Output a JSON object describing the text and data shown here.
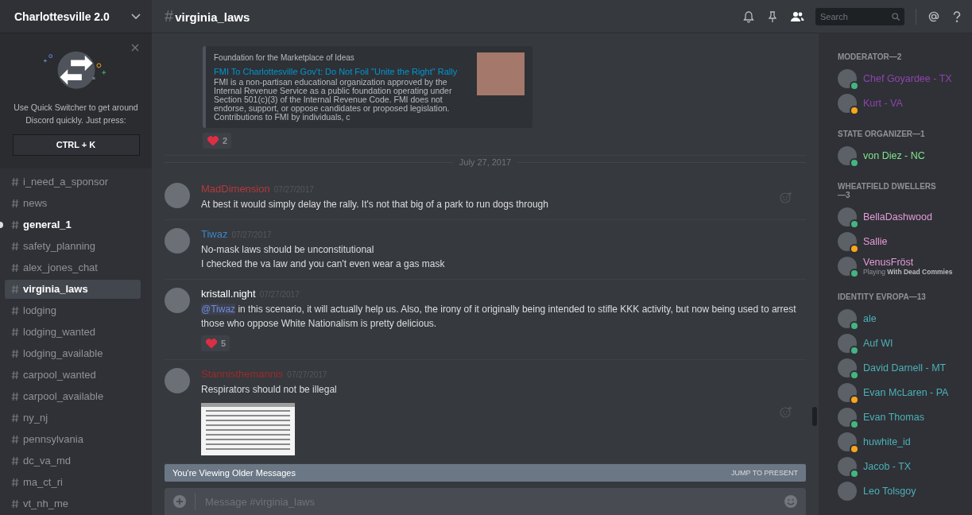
{
  "server": {
    "name": "Charlottesville 2.0"
  },
  "quick_switcher": {
    "text": "Use Quick Switcher to get around Discord quickly. Just press:",
    "shortcut": "CTRL + K"
  },
  "channels": [
    {
      "name": "i_need_a_sponsor",
      "selected": false,
      "unread": false
    },
    {
      "name": "news",
      "selected": false,
      "unread": false
    },
    {
      "name": "general_1",
      "selected": false,
      "unread": true
    },
    {
      "name": "safety_planning",
      "selected": false,
      "unread": false
    },
    {
      "name": "alex_jones_chat",
      "selected": false,
      "unread": false
    },
    {
      "name": "virginia_laws",
      "selected": true,
      "unread": false
    },
    {
      "name": "lodging",
      "selected": false,
      "unread": false
    },
    {
      "name": "lodging_wanted",
      "selected": false,
      "unread": false
    },
    {
      "name": "lodging_available",
      "selected": false,
      "unread": false
    },
    {
      "name": "carpool_wanted",
      "selected": false,
      "unread": false
    },
    {
      "name": "carpool_available",
      "selected": false,
      "unread": false
    },
    {
      "name": "ny_nj",
      "selected": false,
      "unread": false
    },
    {
      "name": "pennsylvania",
      "selected": false,
      "unread": false
    },
    {
      "name": "dc_va_md",
      "selected": false,
      "unread": false
    },
    {
      "name": "ma_ct_ri",
      "selected": false,
      "unread": false
    },
    {
      "name": "vt_nh_me",
      "selected": false,
      "unread": false
    }
  ],
  "header": {
    "hash": "#",
    "channel": "virginia_laws",
    "search": {
      "placeholder": "Search"
    },
    "members_on": true
  },
  "chat": [
    {
      "kind": "continuation",
      "embed": {
        "provider": "Foundation for the Marketplace of Ideas",
        "title": "FMI To Charlottesville Gov't: Do Not Foil \"Unite the Right\" Rally",
        "description": "FMI is a non-partisan educational organization approved by the Internal Revenue Service as a public foundation operating under Section 501(c)(3) of the Internal Revenue Code.  FMI does not endorse, support, or oppose candidates or proposed legislation. Contributions to FMI by individuals, c"
      },
      "reactions": [
        {
          "count": "2"
        }
      ]
    },
    {
      "kind": "divider",
      "label": "July 27, 2017"
    },
    {
      "kind": "message",
      "author": {
        "name": "MadDimension",
        "color": "#b33a3a"
      },
      "timestamp": "07/27/2017",
      "lines": [
        {
          "text": "At best it would simply delay the rally. It's not that big of a park to run dogs through"
        }
      ],
      "reaction_button": true
    },
    {
      "kind": "message",
      "author": {
        "name": "Tiwaz",
        "color": "#3d84c6"
      },
      "timestamp": "07/27/2017",
      "lines": [
        {
          "text": "No-mask laws should be unconstitutional"
        },
        {
          "text": "I checked the va law and you can't even wear a gas mask"
        }
      ],
      "reaction_button": false
    },
    {
      "kind": "message",
      "author": {
        "name": "kristall.night",
        "color": "#ffffff"
      },
      "timestamp": "07/27/2017",
      "lines": [
        {
          "mention": "@Tiwaz",
          "text": "in this scenario, it will actually help us. Also, the irony of it originally being intended to stifle KKK activity, but now being used to arrest those who oppose White Nationalism is pretty delicious."
        }
      ],
      "reactions": [
        {
          "count": "5"
        }
      ],
      "reaction_button": false
    },
    {
      "kind": "message",
      "author": {
        "name": "Stannisthemannis",
        "color": "#9a2c2c"
      },
      "timestamp": "07/27/2017",
      "lines": [
        {
          "text": "Respirators should not be illegal"
        }
      ],
      "attachments": [
        {
          "kind": "image"
        }
      ],
      "reaction_button": true
    }
  ],
  "older_bar": {
    "label": "You're Viewing Older Messages",
    "action": "JUMP TO PRESENT"
  },
  "composer": {
    "placeholder": "Message #virginia_laws"
  },
  "member_groups": [
    {
      "title": "MODERATOR—2",
      "members": [
        {
          "name": "Chef Goyardee - TX",
          "color": "#8e44ad",
          "status": {
            "color": "#43b581"
          }
        },
        {
          "name": "Kurt - VA",
          "color": "#8e44ad",
          "status": {
            "color": "#faa61a"
          }
        }
      ]
    },
    {
      "title": "STATE ORGANIZER—1",
      "members": [
        {
          "name": "von Diez - NC",
          "color": "#7ee58c",
          "status": {
            "color": "#43b581"
          }
        }
      ]
    },
    {
      "title": "WHEATFIELD DWELLERS—3",
      "members": [
        {
          "name": "BellaDashwood",
          "color": "#e59bd8",
          "status": {
            "color": "#43b581"
          }
        },
        {
          "name": "Sallie",
          "color": "#e59bd8",
          "status": {
            "color": "#faa61a"
          }
        },
        {
          "name": "VenusFröst",
          "color": "#e59bd8",
          "status": {
            "color": "#43b581"
          },
          "activity": "Playing **With Dead Commies**"
        }
      ]
    },
    {
      "title": "IDENTITY EVROPA—13",
      "members": [
        {
          "name": "ale",
          "color": "#4cb0b8",
          "status": {
            "color": "#43b581"
          }
        },
        {
          "name": "Auf WI",
          "color": "#4cb0b8",
          "status": {
            "color": "#43b581"
          }
        },
        {
          "name": "David Darnell - MT",
          "color": "#4cb0b8",
          "status": {
            "color": "#43b581"
          }
        },
        {
          "name": "Evan McLaren - PA",
          "color": "#4cb0b8",
          "status": {
            "color": "#faa61a"
          }
        },
        {
          "name": "Evan Thomas",
          "color": "#4cb0b8",
          "status": {
            "color": "#43b581"
          }
        },
        {
          "name": "huwhite_id",
          "color": "#4cb0b8",
          "status": {
            "color": "#faa61a"
          }
        },
        {
          "name": "Jacob - TX",
          "color": "#4cb0b8",
          "status": {
            "color": "#43b581"
          }
        },
        {
          "name": "Leo Tolsgoy",
          "color": "#4cb0b8"
        }
      ]
    }
  ]
}
